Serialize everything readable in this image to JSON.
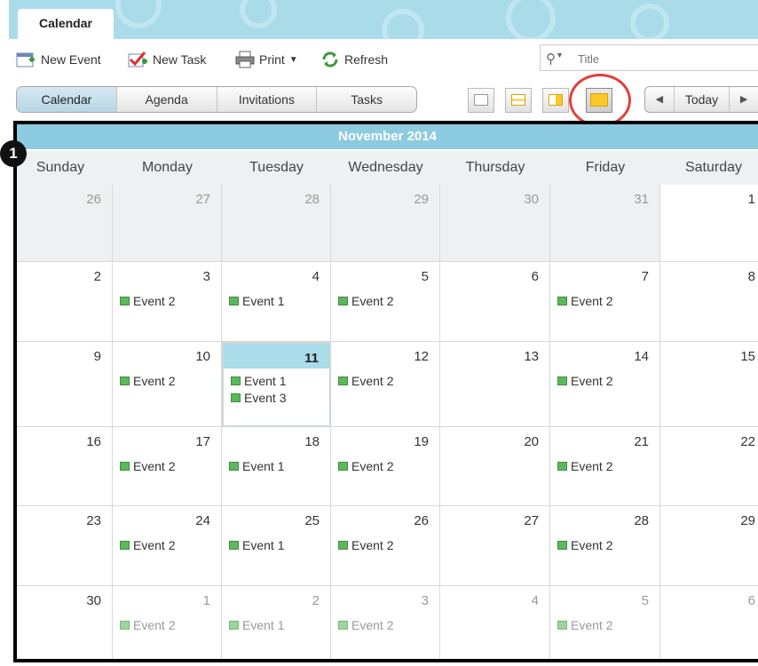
{
  "app_tab": "Calendar",
  "toolbar": {
    "new_event": "New Event",
    "new_task": "New Task",
    "print": "Print",
    "refresh": "Refresh",
    "search_placeholder": "Title"
  },
  "views": [
    "Calendar",
    "Agenda",
    "Invitations",
    "Tasks"
  ],
  "active_view": "Calendar",
  "nav": {
    "today": "Today",
    "prev": "◀",
    "next": "▶"
  },
  "badge": "1",
  "month_title": "November 2014",
  "day_names": [
    "Sunday",
    "Monday",
    "Tuesday",
    "Wednesday",
    "Thursday",
    "Friday",
    "Saturday"
  ],
  "weeks": [
    [
      {
        "d": "26",
        "other": true,
        "events": []
      },
      {
        "d": "27",
        "other": true,
        "events": []
      },
      {
        "d": "28",
        "other": true,
        "events": []
      },
      {
        "d": "29",
        "other": true,
        "events": []
      },
      {
        "d": "30",
        "other": true,
        "events": []
      },
      {
        "d": "31",
        "other": true,
        "events": []
      },
      {
        "d": "1",
        "events": []
      }
    ],
    [
      {
        "d": "2",
        "events": []
      },
      {
        "d": "3",
        "events": [
          "Event 2"
        ]
      },
      {
        "d": "4",
        "events": [
          "Event 1"
        ]
      },
      {
        "d": "5",
        "events": [
          "Event 2"
        ]
      },
      {
        "d": "6",
        "events": []
      },
      {
        "d": "7",
        "events": [
          "Event 2"
        ]
      },
      {
        "d": "8",
        "events": []
      }
    ],
    [
      {
        "d": "9",
        "events": []
      },
      {
        "d": "10",
        "events": [
          "Event 2"
        ]
      },
      {
        "d": "11",
        "today": true,
        "events": [
          "Event 1",
          "Event 3"
        ]
      },
      {
        "d": "12",
        "events": [
          "Event 2"
        ]
      },
      {
        "d": "13",
        "events": []
      },
      {
        "d": "14",
        "events": [
          "Event 2"
        ]
      },
      {
        "d": "15",
        "events": []
      }
    ],
    [
      {
        "d": "16",
        "events": []
      },
      {
        "d": "17",
        "events": [
          "Event 2"
        ]
      },
      {
        "d": "18",
        "events": [
          "Event 1"
        ]
      },
      {
        "d": "19",
        "events": [
          "Event 2"
        ]
      },
      {
        "d": "20",
        "events": []
      },
      {
        "d": "21",
        "events": [
          "Event 2"
        ]
      },
      {
        "d": "22",
        "events": []
      }
    ],
    [
      {
        "d": "23",
        "events": []
      },
      {
        "d": "24",
        "events": [
          "Event 2"
        ]
      },
      {
        "d": "25",
        "events": [
          "Event 1"
        ]
      },
      {
        "d": "26",
        "events": [
          "Event 2"
        ]
      },
      {
        "d": "27",
        "events": []
      },
      {
        "d": "28",
        "events": [
          "Event 2"
        ]
      },
      {
        "d": "29",
        "events": []
      }
    ],
    [
      {
        "d": "30",
        "events": []
      },
      {
        "d": "1",
        "dim": true,
        "events": [
          "Event 2"
        ]
      },
      {
        "d": "2",
        "dim": true,
        "events": [
          "Event 1"
        ]
      },
      {
        "d": "3",
        "dim": true,
        "events": [
          "Event 2"
        ]
      },
      {
        "d": "4",
        "dim": true,
        "events": []
      },
      {
        "d": "5",
        "dim": true,
        "events": [
          "Event 2"
        ]
      },
      {
        "d": "6",
        "dim": true,
        "events": []
      }
    ]
  ],
  "colors": {
    "header_blue": "#8ccbe0",
    "event_green": "#5cb85c",
    "highlight_red": "#e0413b"
  }
}
